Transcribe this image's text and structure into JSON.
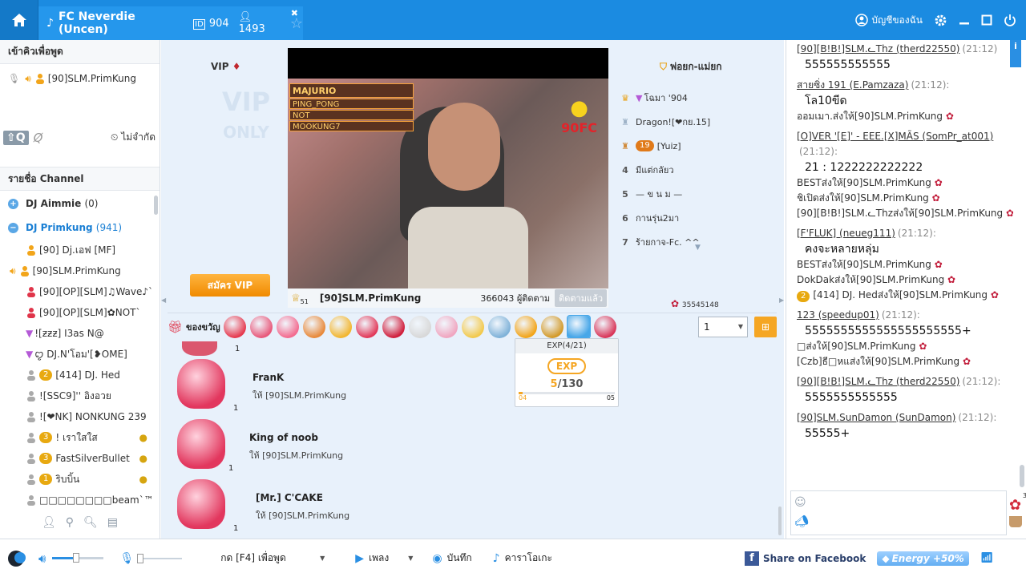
{
  "titlebar": {
    "channel_name": "FC Neverdie (Uncen)",
    "room_id": "904",
    "users_count": "1493",
    "account_label": "บัญชีของฉัน"
  },
  "left": {
    "queue_title": "เข้าคิวเพื่อพูด",
    "queue_user": "[90]SLM.PrimKung",
    "unlimited_label": "ไม่จำกัด",
    "channel_list_title": "รายชื่อ Channel",
    "channels": [
      {
        "name": "DJ Aimmie",
        "count": "(0)"
      },
      {
        "name": "DJ Primkung",
        "count": "(941)"
      }
    ],
    "users": [
      {
        "name": "[90] Dj.เอฟ [MF]",
        "badge": ""
      },
      {
        "name": "[90]SLM.PrimKung",
        "badge": ""
      },
      {
        "name": "[90][OP][SLM]♫Wave♪`",
        "badge": ""
      },
      {
        "name": "[90][OP][SLM]✿NOT`",
        "badge": ""
      },
      {
        "name": "![ƶƶƶ] I3as N@",
        "badge": ""
      },
      {
        "name": "ꨄ DJ.N'โอม'[❥OME]",
        "badge": ""
      },
      {
        "name": "[414] DJ. Hed",
        "badge": "2"
      },
      {
        "name": "![SSC9]'' อิงอวย",
        "badge": ""
      },
      {
        "name": "![❤NK] NONKUNG 239",
        "badge": ""
      },
      {
        "name": "! เราใสใส",
        "badge": "3"
      },
      {
        "name": "FastSilverBullet",
        "badge": "3"
      },
      {
        "name": "ริบบิ้น",
        "badge": "1"
      },
      {
        "name": "□□□□□□□□beam`™",
        "badge": ""
      }
    ]
  },
  "stage": {
    "vip_label": "VIP",
    "vip_button": "สมัคร VIP",
    "father_mother_label": "พ่อยก-แม่ยก",
    "video_overlay_names": [
      "MAJURIO",
      "PING_PONG",
      "NOT",
      "MOOKUNG7"
    ],
    "video_badge": "90FC",
    "broadcaster_name": "[90]SLM.PrimKung",
    "broadcaster_level": "51",
    "followers": "366043 ผู้ติดตาม",
    "following_button": "ติดตามแล้ว",
    "rose_count": "35545148",
    "donors": [
      {
        "rank": "1",
        "name": "โฉมา '904"
      },
      {
        "rank": "2",
        "name": "Dragon![❤กย.15]"
      },
      {
        "rank": "3",
        "name": "[Yuiz]",
        "badge": "19"
      },
      {
        "rank": "4",
        "name": "มีแต่กลัยว"
      },
      {
        "rank": "5",
        "name": "— ข น ม —"
      },
      {
        "rank": "6",
        "name": "กานรุ่น2มา"
      },
      {
        "rank": "7",
        "name": "ร้ายกาจ-Fc. ^^"
      }
    ],
    "gift_label": "ของขวัญ",
    "gift_qty": "1",
    "gift_feed": [
      {
        "sender": "FranK",
        "to": "ให้ [90]SLM.PrimKung",
        "qty": "1"
      },
      {
        "sender": "King of noob",
        "to": "ให้ [90]SLM.PrimKung",
        "qty": "1"
      },
      {
        "sender": "[Mr.] C'CAKE",
        "to": "ให้ [90]SLM.PrimKung",
        "qty": "1"
      }
    ],
    "top_feed_qty": "1",
    "exp": {
      "title": "EXP(4/21)",
      "label": "EXP",
      "current": "5",
      "total": "/130",
      "from": "04",
      "to": "05",
      "progress": 0.04
    }
  },
  "chat": {
    "messages": [
      {
        "who": "[90][B!B!]SLM.ᓚThz (therd22550)",
        "time": "(21:12)",
        "text": "555555555555"
      },
      {
        "who": "สายซิ่ง 191 (E.Pamzaza)",
        "time": "(21:12):",
        "text": "โล10ขีด"
      },
      {
        "sys": "ออมเมา.ส่งให้[90]SLM.PrimKung"
      },
      {
        "who": "[O]VER '[E]' - EEE.[X]MÃS (SomPr_at001)",
        "time": "(21:12):",
        "text": "21 : 1222222222222"
      },
      {
        "sys": "BESTส่งให้[90]SLM.PrimKung"
      },
      {
        "sys": "ชิเปิดส่งให้[90]SLM.PrimKung"
      },
      {
        "sys": "[90][B!B!]SLM.ᓚThzส่งให้[90]SLM.PrimKung"
      },
      {
        "who": "[F'FLUK] (neueg111)",
        "time": "(21:12):",
        "text": "คงจะหลายหลุ่ม"
      },
      {
        "sys": "BESTส่งให้[90]SLM.PrimKung"
      },
      {
        "sys": "DokDakส่งให้[90]SLM.PrimKung"
      },
      {
        "sys": "[414] DJ. Hedส่งให้[90]SLM.PrimKung",
        "badge": "2"
      },
      {
        "who": "123 (speedup01)",
        "time": "(21:12):",
        "text": "5555555555555555555555+"
      },
      {
        "sys": "□ส่งให้[90]SLM.PrimKung"
      },
      {
        "sys": "[Czb]ธี□หแส่งให้[90]SLM.PrimKung"
      },
      {
        "who": "[90][B!B!]SLM.ᓚThz (therd22550)",
        "time": "(21:12):",
        "text": "5555555555555"
      },
      {
        "who": "[90]SLM.SunDamon (SunDamon)",
        "time": "(21:12):",
        "text": "55555+"
      }
    ],
    "rose_badge": "3"
  },
  "bottom": {
    "push_to_talk": "กด [F4] เพื่อพูด",
    "play_label": "เพลง",
    "record_label": "บันทึก",
    "karaoke_label": "คาราโอเกะ",
    "share_fb": "Share on Facebook",
    "energy": "Energy +50%"
  },
  "colors": {
    "titlebar": "#1b8be1",
    "accent_orange": "#f5a623",
    "stage_bg": "#e8f1fb"
  }
}
